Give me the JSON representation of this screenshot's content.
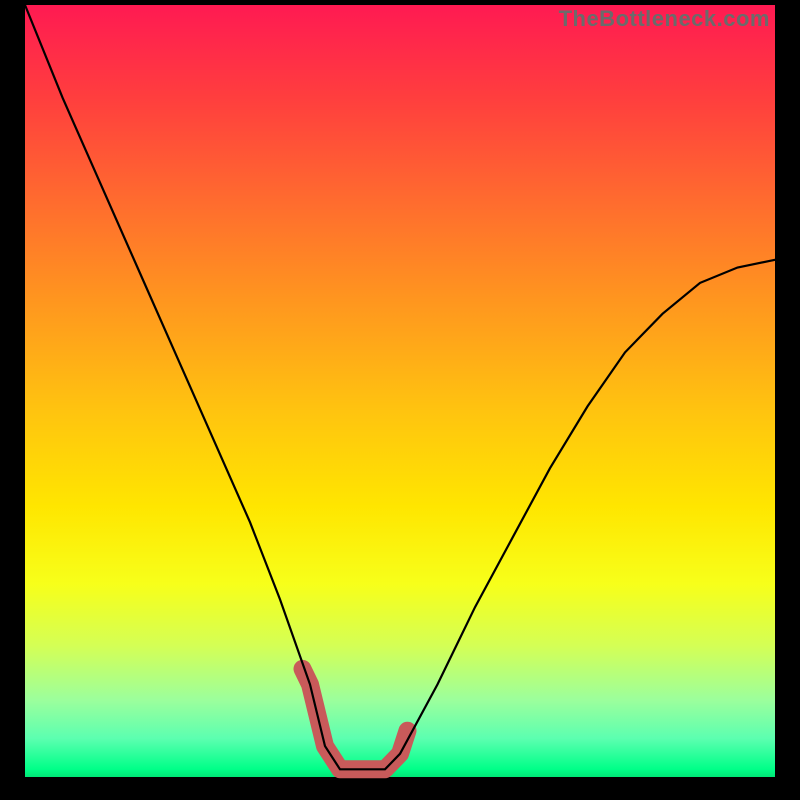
{
  "watermark": "TheBottleneck.com",
  "chart_data": {
    "type": "line",
    "title": "",
    "xlabel": "",
    "ylabel": "",
    "xlim": [
      0,
      100
    ],
    "ylim": [
      0,
      100
    ],
    "series": [
      {
        "name": "bottleneck-curve",
        "x": [
          0,
          5,
          10,
          15,
          20,
          25,
          30,
          34,
          38,
          40,
          42,
          48,
          50,
          55,
          60,
          65,
          70,
          75,
          80,
          85,
          90,
          95,
          100
        ],
        "values": [
          100,
          88,
          77,
          66,
          55,
          44,
          33,
          23,
          12,
          4,
          1,
          1,
          3,
          12,
          22,
          31,
          40,
          48,
          55,
          60,
          64,
          66,
          67
        ]
      }
    ],
    "highlight_segment": {
      "name": "optimal-zone",
      "x": [
        37,
        38,
        40,
        42,
        48,
        50,
        51
      ],
      "values": [
        14,
        12,
        4,
        1,
        1,
        3,
        6
      ],
      "color": "#c85a5a",
      "stroke_width": 18
    },
    "background_gradient": {
      "top": "#ff1a52",
      "mid": "#ffe600",
      "bottom": "#00e676"
    }
  }
}
